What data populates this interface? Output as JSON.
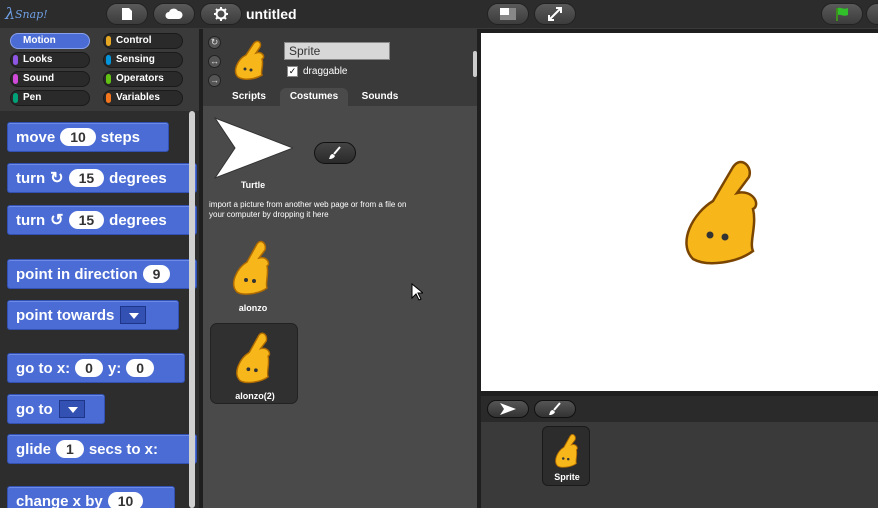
{
  "app": {
    "logo_text": "Snap!",
    "project_title": "untitled"
  },
  "toolbar": {
    "icons": [
      "file-icon",
      "cloud-icon",
      "gear-icon"
    ],
    "stage_icons": [
      "stage-size-icon",
      "fullscreen-icon"
    ],
    "run_icon": "green-flag-icon"
  },
  "categories": [
    {
      "label": "Motion",
      "color": "#4a6cd4",
      "selected": true
    },
    {
      "label": "Control",
      "color": "#e6a822",
      "selected": false
    },
    {
      "label": "Looks",
      "color": "#8f56e3",
      "selected": false
    },
    {
      "label": "Sensing",
      "color": "#0494dc",
      "selected": false
    },
    {
      "label": "Sound",
      "color": "#cf4ad9",
      "selected": false
    },
    {
      "label": "Operators",
      "color": "#62c213",
      "selected": false
    },
    {
      "label": "Pen",
      "color": "#00a178",
      "selected": false
    },
    {
      "label": "Variables",
      "color": "#f3761d",
      "selected": false
    }
  ],
  "blocks": {
    "move": {
      "pre": "move",
      "value": "10",
      "post": "steps"
    },
    "turn_cw": {
      "pre": "turn",
      "value": "15",
      "post": "degrees"
    },
    "turn_ccw": {
      "pre": "turn",
      "value": "15",
      "post": "degrees"
    },
    "point_direction": {
      "pre": "point in direction",
      "value": "9"
    },
    "point_towards": {
      "pre": "point towards"
    },
    "go_to_xy": {
      "pre": "go to x:",
      "x": "0",
      "mid": "y:",
      "y": "0"
    },
    "go_to": {
      "pre": "go to"
    },
    "glide": {
      "pre": "glide",
      "value": "1",
      "post": "secs to x:"
    },
    "change_x": {
      "pre": "change x by",
      "value": "10"
    }
  },
  "sprite": {
    "name": "Sprite",
    "draggable_label": "draggable",
    "draggable_checked": "✓"
  },
  "tabs": [
    {
      "label": "Scripts",
      "active": false
    },
    {
      "label": "Costumes",
      "active": true
    },
    {
      "label": "Sounds",
      "active": false
    }
  ],
  "costumes": {
    "turtle_label": "Turtle",
    "import_hint": "import a picture from another web page or from a file on your computer by dropping it here",
    "items": [
      {
        "label": "alonzo",
        "selected": false
      },
      {
        "label": "alonzo(2)",
        "selected": true
      }
    ]
  },
  "corral": {
    "sprite_label": "Sprite"
  }
}
